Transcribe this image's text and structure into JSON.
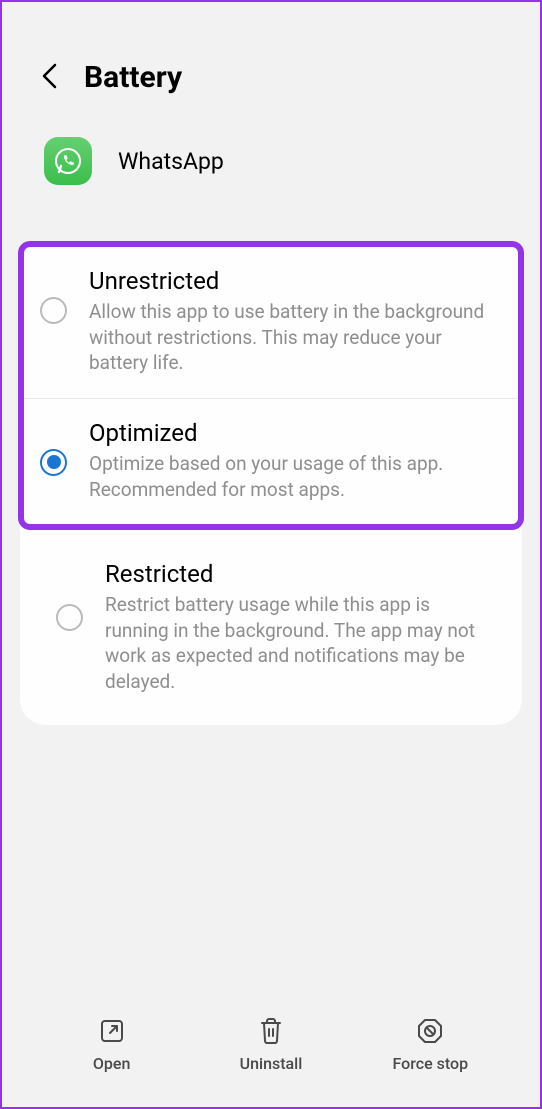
{
  "header": {
    "title": "Battery"
  },
  "app": {
    "name": "WhatsApp"
  },
  "options": {
    "unrestricted": {
      "title": "Unrestricted",
      "desc": "Allow this app to use battery in the background without restrictions. This may reduce your battery life."
    },
    "optimized": {
      "title": "Optimized",
      "desc": "Optimize based on your usage of this app. Recommended for most apps."
    },
    "restricted": {
      "title": "Restricted",
      "desc": "Restrict battery usage while this app is running in the background. The app may not work as expected and notifications may be delayed."
    }
  },
  "bottom": {
    "open": "Open",
    "uninstall": "Uninstall",
    "forcestop": "Force stop"
  }
}
